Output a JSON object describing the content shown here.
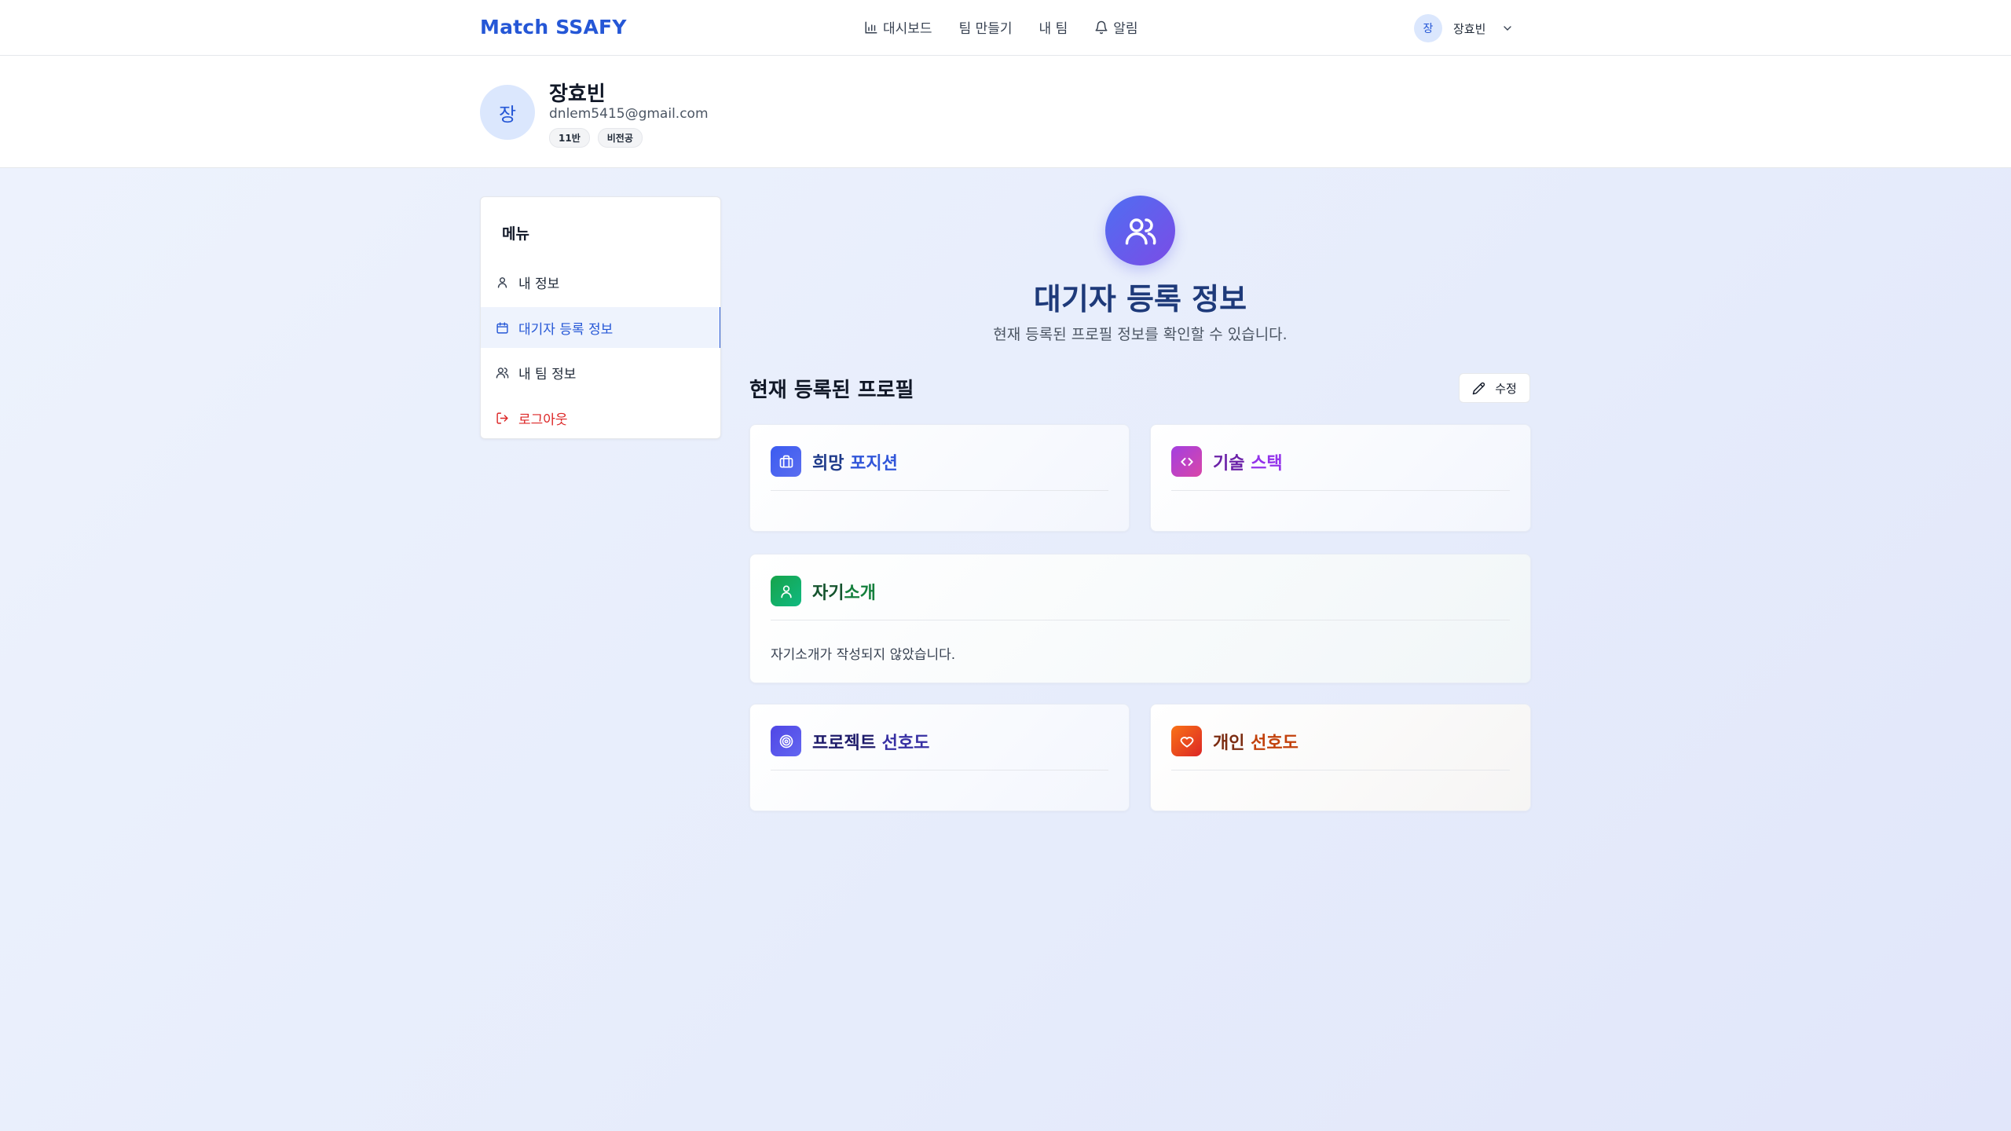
{
  "nav": {
    "brand": "Match SSAFY",
    "links": [
      {
        "label": "대시보드",
        "icon": "bar-chart-icon"
      },
      {
        "label": "팀 만들기"
      },
      {
        "label": "내 팀"
      },
      {
        "label": "알림",
        "icon": "bell-icon"
      }
    ],
    "user": {
      "avatar_initial": "장",
      "name": "장효빈"
    }
  },
  "profile": {
    "avatar_initial": "장",
    "name": "장효빈",
    "email": "dnlem5415@gmail.com",
    "badges": [
      "11반",
      "비전공"
    ]
  },
  "sidebar": {
    "title": "메뉴",
    "items": [
      {
        "label": "내 정보",
        "icon": "user-icon"
      },
      {
        "label": "대기자 등록 정보",
        "icon": "calendar-icon",
        "active": true
      },
      {
        "label": "내 팀 정보",
        "icon": "users-icon"
      },
      {
        "label": "로그아웃",
        "icon": "logout-icon"
      }
    ]
  },
  "main": {
    "hero_title": "대기자 등록 정보",
    "hero_subtitle": "현재 등록된 프로필 정보를 확인할 수 있습니다.",
    "section_title": "현재 등록된 프로필",
    "edit_label": "수정",
    "cards": {
      "position": {
        "title_a": "희망 ",
        "title_b": "포지션",
        "icon": "briefcase-icon"
      },
      "stack": {
        "title_a": "기술 ",
        "title_b": "스택",
        "icon": "code-icon"
      },
      "intro": {
        "title_a": "자기",
        "title_b": "소개",
        "icon": "user-icon",
        "body": "자기소개가 작성되지 않았습니다."
      },
      "project": {
        "title_a": "프로젝트 ",
        "title_b": "선호도",
        "icon": "target-icon"
      },
      "personal": {
        "title_a": "개인 ",
        "title_b": "선호도",
        "icon": "heart-icon"
      }
    }
  },
  "colors": {
    "accent": "#2557d6",
    "danger": "#dc2626",
    "hero_title": "#1e3a7a"
  }
}
